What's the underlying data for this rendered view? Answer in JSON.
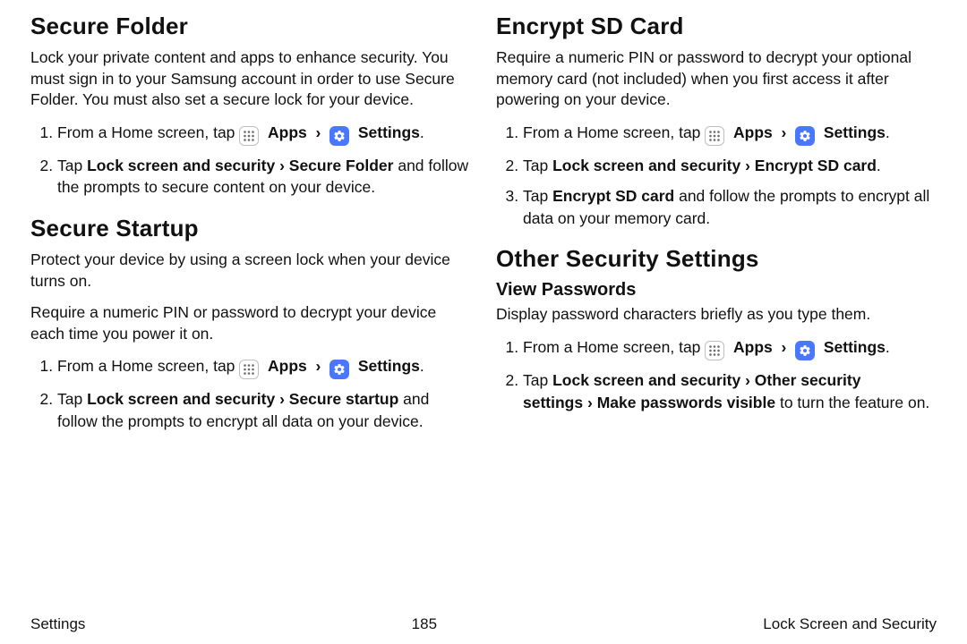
{
  "icons": {
    "apps_name": "apps-icon",
    "settings_name": "settings-icon"
  },
  "labels": {
    "apps": "Apps",
    "settings": "Settings",
    "caret": "›"
  },
  "left": {
    "secureFolder": {
      "title": "Secure Folder",
      "intro": "Lock your private content and apps to enhance security. You must sign in to your Samsung account in order to use Secure Folder. You must also set a secure lock for your device.",
      "step1_pre": "From a Home screen, tap ",
      "step2_a": "Tap ",
      "step2_b": "Lock screen and security",
      "step2_c": "Secure Folder",
      "step2_d": " and follow the prompts to secure content on your device."
    },
    "secureStartup": {
      "title": "Secure Startup",
      "p1": "Protect your device by using a screen lock when your device turns on.",
      "p2": "Require a numeric PIN or password to decrypt your device each time you power it on.",
      "step1_pre": "From a Home screen, tap ",
      "step2_a": "Tap ",
      "step2_b": "Lock screen and security",
      "step2_c": "Secure startup",
      "step2_d": " and follow the prompts to encrypt all data on your device."
    }
  },
  "right": {
    "encryptSD": {
      "title": "Encrypt SD Card",
      "intro": "Require a numeric PIN or password to decrypt your optional memory card (not included) when you first access it after powering on your device.",
      "step1_pre": "From a Home screen, tap ",
      "step2_a": "Tap ",
      "step2_b": "Lock screen and security",
      "step2_c": "Encrypt SD card",
      "step3_a": "Tap ",
      "step3_b": "Encrypt SD card",
      "step3_c": " and follow the prompts to encrypt all data on your memory card."
    },
    "otherSecurity": {
      "title": "Other Security Settings",
      "viewPasswords": {
        "title": "View Passwords",
        "intro": "Display password characters briefly as you type them.",
        "step1_pre": "From a Home screen, tap ",
        "step2_a": "Tap ",
        "step2_b": "Lock screen and security",
        "step2_c": "Other security settings",
        "step2_d": "Make passwords visible",
        "step2_e": " to turn the feature on."
      }
    }
  },
  "footer": {
    "left": "Settings",
    "page": "185",
    "right": "Lock Screen and Security"
  }
}
